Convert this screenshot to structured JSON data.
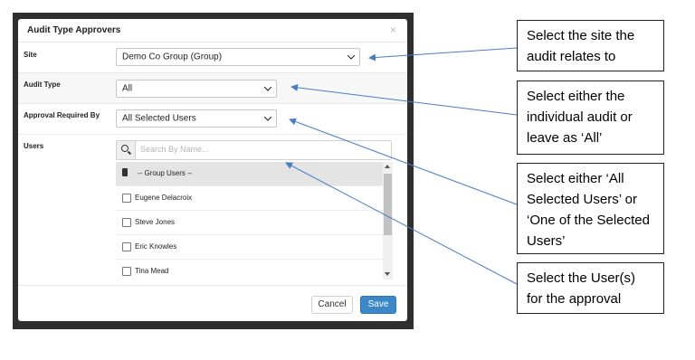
{
  "dialog": {
    "title": "Audit Type Approvers",
    "close_glyph": "×",
    "site": {
      "label": "Site",
      "value": "Demo Co Group (Group)"
    },
    "audit_type": {
      "label": "Audit Type",
      "value": "All"
    },
    "approval": {
      "label": "Approval Required By",
      "value": "All Selected Users"
    },
    "users": {
      "label": "Users",
      "search_placeholder": "Search By Name...",
      "group_header": "-- Group Users --",
      "items": [
        "Eugene Delacroix",
        "Steve Jones",
        "Eric Knowles",
        "Tina Mead"
      ]
    },
    "cancel_label": "Cancel",
    "save_label": "Save"
  },
  "callouts": [
    "Select the site the audit relates to",
    "Select either the individual audit or leave as ‘All’",
    "Select either ‘All Selected Users’ or ‘One of the Selected Users’",
    "Select the User(s) for the approval"
  ],
  "colors": {
    "save_button": "#3b87c8",
    "arrow": "#4a7ec2",
    "backdrop": "#2f2f2f"
  }
}
